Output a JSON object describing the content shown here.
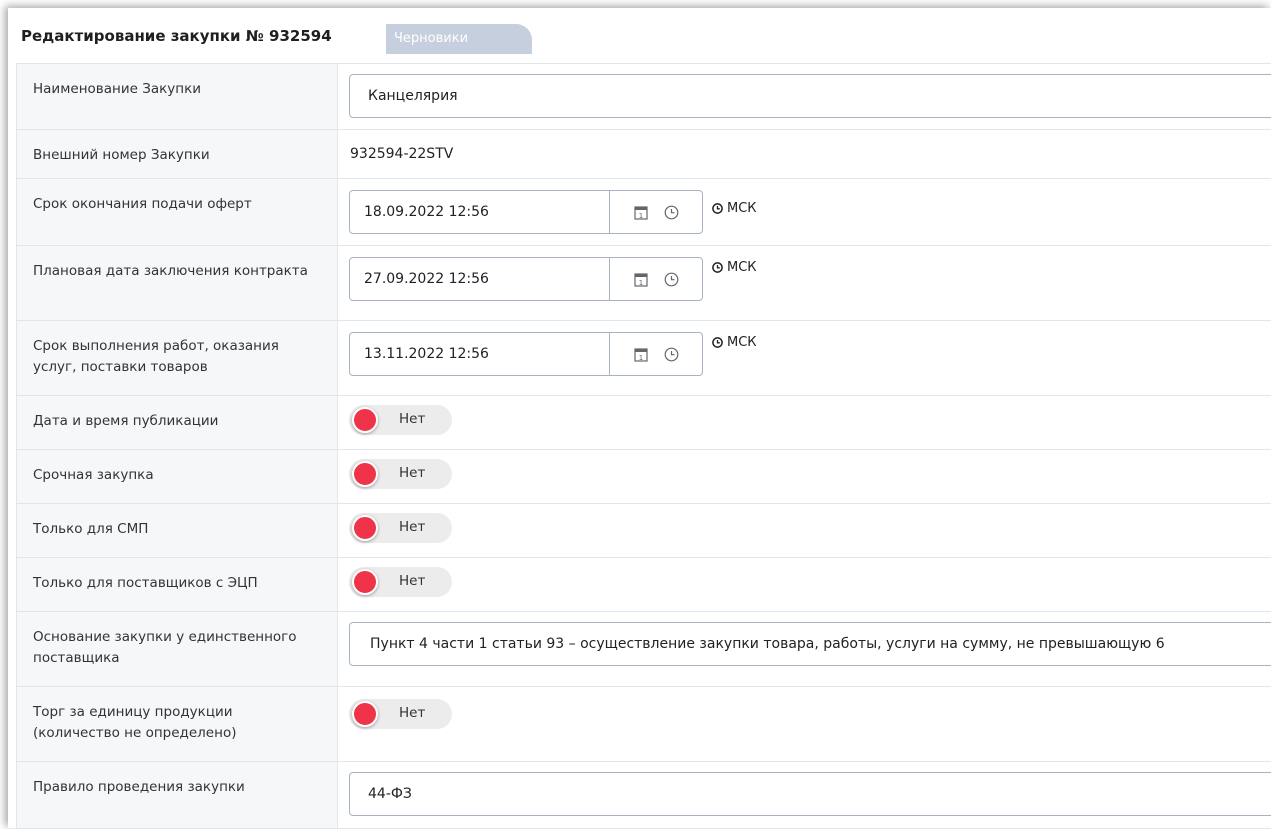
{
  "header": {
    "title": "Редактирование закупки № 932594",
    "status_badge": "Черновики"
  },
  "form": {
    "name": {
      "label": "Наименование Закупки",
      "value": "Канцелярия"
    },
    "external_number": {
      "label": "Внешний номер Закупки",
      "value": "932594-22STV"
    },
    "offer_deadline": {
      "label": "Срок окончания подачи оферт",
      "value": "18.09.2022 12:56",
      "tz": "МСК"
    },
    "contract_date": {
      "label": "Плановая дата заключения контракта",
      "value": "27.09.2022 12:56",
      "tz": "МСК"
    },
    "delivery_date": {
      "label": "Срок выполнения работ, оказания услуг, поставки товаров",
      "value": "13.11.2022 12:56",
      "tz": "МСК"
    },
    "publish_datetime": {
      "label": "Дата и время публикации",
      "toggle": "Нет"
    },
    "urgent": {
      "label": "Срочная закупка",
      "toggle": "Нет"
    },
    "smp_only": {
      "label": "Только для СМП",
      "toggle": "Нет"
    },
    "ecp_only": {
      "label": "Только для поставщиков с ЭЦП",
      "toggle": "Нет"
    },
    "single_supplier_basis": {
      "label": "Основание закупки у единственного поставщика",
      "value": "Пункт 4 части 1 статьи 93 – осуществление закупки товара, работы, услуги на сумму, не превышающую 6"
    },
    "unit_bidding": {
      "label": "Торг за единицу продукции (количество не определено)",
      "toggle": "Нет"
    },
    "procurement_rule": {
      "label": "Правило проведения закупки",
      "value": "44-ФЗ"
    }
  },
  "colors": {
    "toggle_off": "#ef3349",
    "badge_bg": "#c6cfdd",
    "border": "#a9b4c2"
  },
  "icons": [
    "calendar-icon",
    "clock-icon",
    "timezone-clock-icon"
  ]
}
